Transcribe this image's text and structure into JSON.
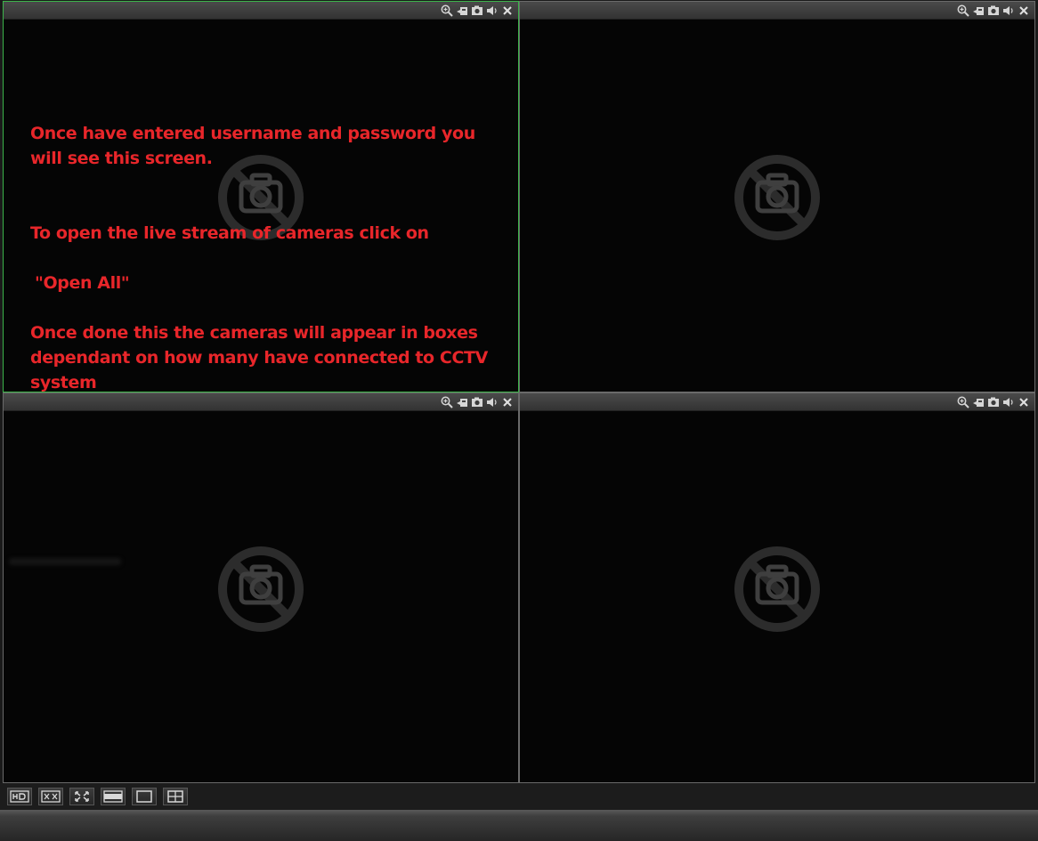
{
  "colors": {
    "selected_border": "#3cb44a",
    "note_text": "#e8262a",
    "pane_background": "#050505"
  },
  "pane_tools": [
    "zoom-icon",
    "record-icon",
    "snapshot-icon",
    "audio-icon",
    "close-icon"
  ],
  "panes": [
    {
      "id": 1,
      "selected": true,
      "placeholder": "no-video-camera-icon"
    },
    {
      "id": 2,
      "selected": false,
      "placeholder": "no-video-camera-icon"
    },
    {
      "id": 3,
      "selected": false,
      "placeholder": "no-video-camera-icon"
    },
    {
      "id": 4,
      "selected": false,
      "placeholder": "no-video-camera-icon"
    }
  ],
  "note": {
    "line1": "Once have entered username and password you will see this screen.",
    "line2": "To open the live stream of cameras click on",
    "line3": "\"Open All\"",
    "line4": "Once done this the cameras will appear in boxes dependant on how many have connected to CCTV system"
  },
  "toolbar": {
    "buttons": [
      "hd-icon",
      "fit-icon",
      "fullscreen-icon",
      "wide-layout-icon",
      "single-layout-icon",
      "quad-layout-icon"
    ]
  }
}
